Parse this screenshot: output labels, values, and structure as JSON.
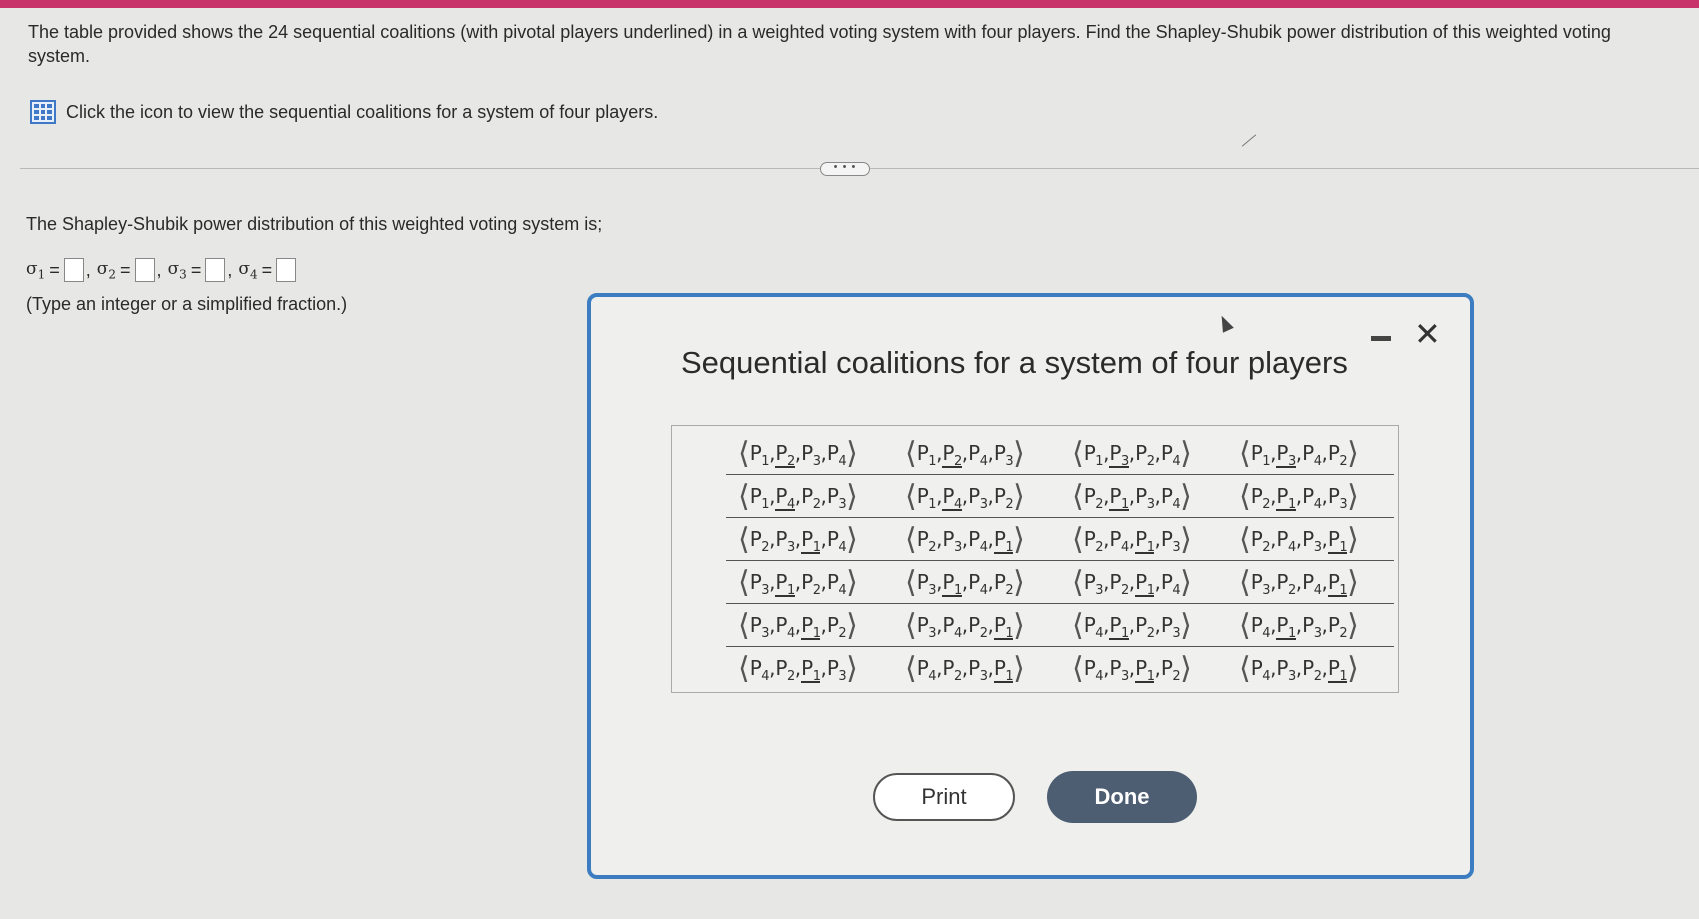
{
  "question": {
    "text": "The table provided shows the 24 sequential coalitions (with pivotal players underlined) in a weighted voting system with four players. Find the Shapley-Shubik power distribution of this weighted voting system.",
    "link_label": "Click the icon to view the sequential coalitions for a system of four players.",
    "more_label": "• • •"
  },
  "answer": {
    "intro": "The Shapley-Shubik power distribution of this weighted voting system is;",
    "symbol": "σ",
    "indices": [
      "1",
      "2",
      "3",
      "4"
    ],
    "hint": "(Type an integer or a simplified fraction.)"
  },
  "modal": {
    "title": "Sequential coalitions for a system of four players",
    "close_glyph": "✕",
    "print_label": "Print",
    "done_label": "Done",
    "player_letter": "P",
    "rows": [
      [
        {
          "order": [
            "1",
            "2",
            "3",
            "4"
          ],
          "pivot": 1
        },
        {
          "order": [
            "1",
            "2",
            "4",
            "3"
          ],
          "pivot": 1
        },
        {
          "order": [
            "1",
            "3",
            "2",
            "4"
          ],
          "pivot": 1
        },
        {
          "order": [
            "1",
            "3",
            "4",
            "2"
          ],
          "pivot": 1
        }
      ],
      [
        {
          "order": [
            "1",
            "4",
            "2",
            "3"
          ],
          "pivot": 1
        },
        {
          "order": [
            "1",
            "4",
            "3",
            "2"
          ],
          "pivot": 1
        },
        {
          "order": [
            "2",
            "1",
            "3",
            "4"
          ],
          "pivot": 1
        },
        {
          "order": [
            "2",
            "1",
            "4",
            "3"
          ],
          "pivot": 1
        }
      ],
      [
        {
          "order": [
            "2",
            "3",
            "1",
            "4"
          ],
          "pivot": 2
        },
        {
          "order": [
            "2",
            "3",
            "4",
            "1"
          ],
          "pivot": 3
        },
        {
          "order": [
            "2",
            "4",
            "1",
            "3"
          ],
          "pivot": 2
        },
        {
          "order": [
            "2",
            "4",
            "3",
            "1"
          ],
          "pivot": 3
        }
      ],
      [
        {
          "order": [
            "3",
            "1",
            "2",
            "4"
          ],
          "pivot": 1
        },
        {
          "order": [
            "3",
            "1",
            "4",
            "2"
          ],
          "pivot": 1
        },
        {
          "order": [
            "3",
            "2",
            "1",
            "4"
          ],
          "pivot": 2
        },
        {
          "order": [
            "3",
            "2",
            "4",
            "1"
          ],
          "pivot": 3
        }
      ],
      [
        {
          "order": [
            "3",
            "4",
            "1",
            "2"
          ],
          "pivot": 2
        },
        {
          "order": [
            "3",
            "4",
            "2",
            "1"
          ],
          "pivot": 3
        },
        {
          "order": [
            "4",
            "1",
            "2",
            "3"
          ],
          "pivot": 1
        },
        {
          "order": [
            "4",
            "1",
            "3",
            "2"
          ],
          "pivot": 1
        }
      ],
      [
        {
          "order": [
            "4",
            "2",
            "1",
            "3"
          ],
          "pivot": 2
        },
        {
          "order": [
            "4",
            "2",
            "3",
            "1"
          ],
          "pivot": 3
        },
        {
          "order": [
            "4",
            "3",
            "1",
            "2"
          ],
          "pivot": 2
        },
        {
          "order": [
            "4",
            "3",
            "2",
            "1"
          ],
          "pivot": 3
        }
      ]
    ]
  }
}
